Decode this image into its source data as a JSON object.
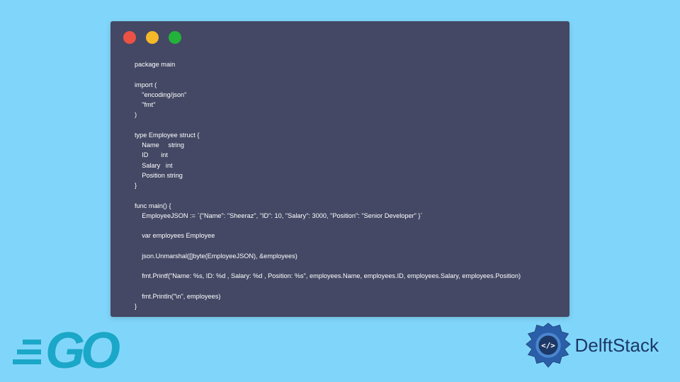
{
  "code": {
    "lines": [
      "package main",
      "",
      "import (",
      "    \"encoding/json\"",
      "    \"fmt\"",
      ")",
      "",
      "type Employee struct {",
      "    Name     string",
      "    ID       int",
      "    Salary   int",
      "    Position string",
      "}",
      "",
      "func main() {",
      "    EmployeeJSON := `{\"Name\": \"Sheeraz\", \"ID\": 10, \"Salary\": 3000, \"Position\": \"Senior Developer\" }`",
      "",
      "    var employees Employee",
      "",
      "    json.Unmarshal([]byte(EmployeeJSON), &employees)",
      "",
      "    fmt.Printf(\"Name: %s, ID: %d , Salary: %d , Position: %s\", employees.Name, employees.ID, employees.Salary, employees.Position)",
      "",
      "    fmt.Println(\"\\n\", employees)",
      "}"
    ]
  },
  "branding": {
    "go_text": "GO",
    "delft_text": "DelftStack",
    "delft_code": "</>"
  },
  "colors": {
    "bg": "#80d6fa",
    "window": "#444864",
    "go": "#1ba7c7",
    "delft": "#1c3867"
  }
}
